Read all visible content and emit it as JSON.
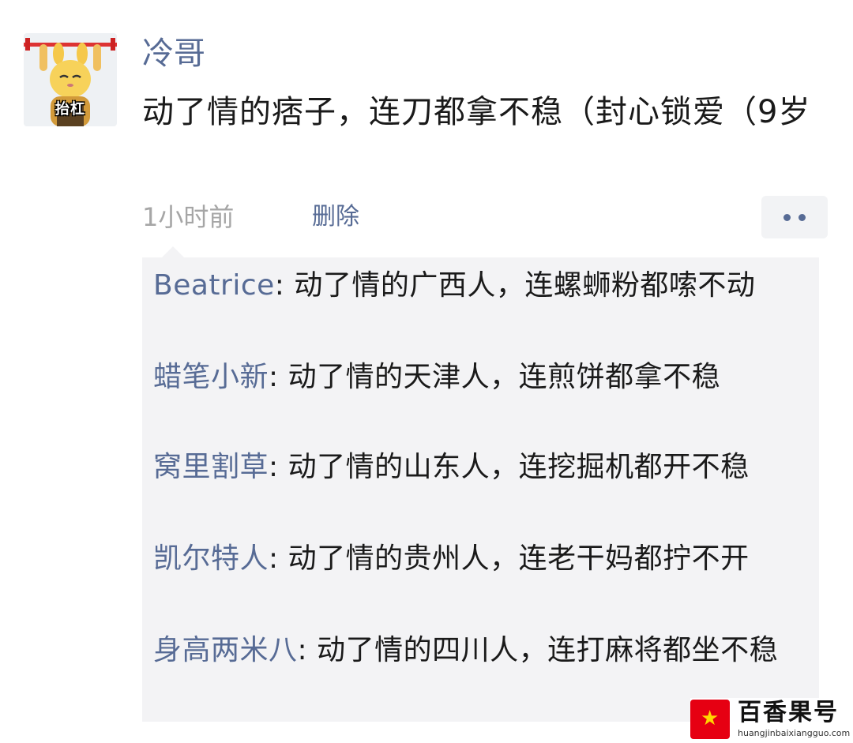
{
  "post": {
    "author": "冷哥",
    "text": "动了情的痞子，连刀都拿不稳（封心锁爱（9岁",
    "avatar_label": "抬杠",
    "time": "1小时前",
    "delete_label": "删除",
    "more_icon": "more-dots-icon"
  },
  "comments": [
    {
      "name": "Beatrice",
      "text": ": 动了情的广西人，连螺蛳粉都嗦不动"
    },
    {
      "name": "蜡笔小新",
      "text": ": 动了情的天津人，连煎饼都拿不稳"
    },
    {
      "name": "窝里割草",
      "text": ": 动了情的山东人，连挖掘机都开不稳"
    },
    {
      "name": "凯尔特人",
      "text": ": 动了情的贵州人，连老干妈都拧不开"
    },
    {
      "name": "身高两米八",
      "text": ": 动了情的四川人，连打麻将都坐不稳"
    }
  ],
  "watermark": {
    "title": "百香果号",
    "url": "huangjinbaixiangguo.com"
  },
  "colors": {
    "link": "#576b95",
    "time": "#a6a6a6",
    "comment_bg": "#f3f3f5",
    "watermark_red": "#e60012"
  }
}
